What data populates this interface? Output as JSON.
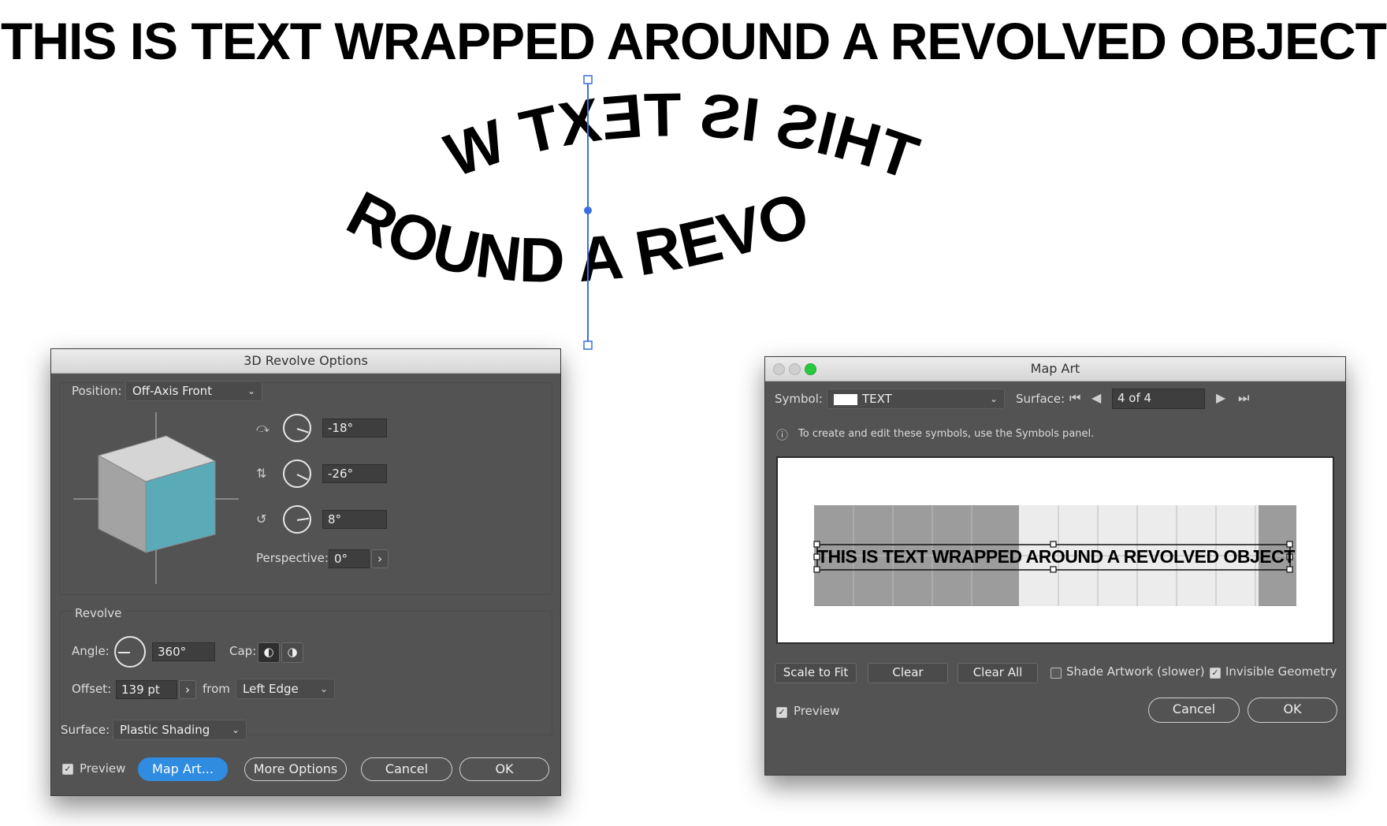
{
  "headline": "THIS IS TEXT WRAPPED AROUND  A REVOLVED OBJECT",
  "ring_text": {
    "top": "THIS IS TEXT WRAPPED",
    "bottom": "ROUND  A REVOLVED OBJ"
  },
  "revolve_dialog": {
    "title": "3D Revolve Options",
    "position_label": "Position:",
    "position_value": "Off-Axis Front",
    "rot_x": "-18°",
    "rot_y": "-26°",
    "rot_z": "8°",
    "perspective_label": "Perspective:",
    "perspective_value": "0°",
    "revolve_label": "Revolve",
    "angle_label": "Angle:",
    "angle_value": "360°",
    "cap_label": "Cap:",
    "offset_label": "Offset:",
    "offset_value": "139 pt",
    "from_label": "from",
    "from_value": "Left Edge",
    "surface_label": "Surface:",
    "surface_value": "Plastic Shading",
    "preview_label": "Preview",
    "map_art_button": "Map Art...",
    "more_options_button": "More Options",
    "cancel_button": "Cancel",
    "ok_button": "OK",
    "cube_face_color": "#5aaab8"
  },
  "map_art_dialog": {
    "title": "Map Art",
    "symbol_label": "Symbol:",
    "symbol_value": "TEXT",
    "surface_label": "Surface:",
    "surface_value": "4 of 4",
    "info_text": "To create and edit these symbols, use the Symbols panel.",
    "preview_art_text": "THIS IS TEXT WRAPPED AROUND  A REVOLVED OBJECT",
    "scale_to_fit_button": "Scale to Fit",
    "clear_button": "Clear",
    "clear_all_button": "Clear All",
    "shade_artwork_label": "Shade Artwork (slower)",
    "invisible_geometry_label": "Invisible Geometry",
    "preview_label": "Preview",
    "cancel_button": "Cancel",
    "ok_button": "OK"
  }
}
